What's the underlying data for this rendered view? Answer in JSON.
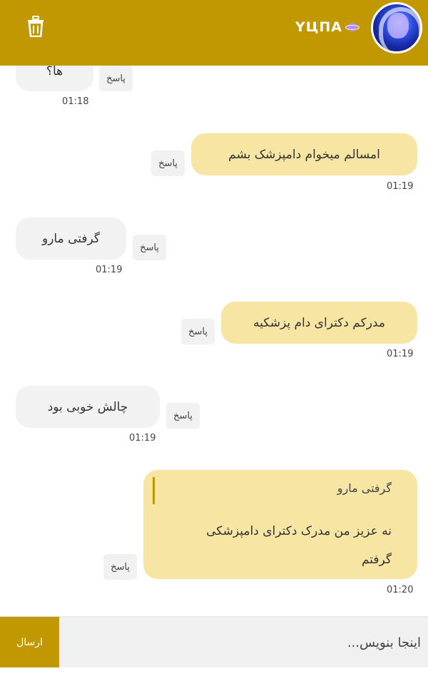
{
  "header": {
    "title": "YЦПA",
    "avatar_icon": "avatar",
    "delete_icon": "trash-icon",
    "planet_icon": "planet-icon",
    "background": "#c19802"
  },
  "messages": [
    {
      "direction": "in",
      "text": "ها؟",
      "reply_label": "پاسخ",
      "time": "01:18"
    },
    {
      "direction": "out",
      "text": "امسالم میخوام دامپزشک بشم",
      "reply_label": "پاسخ",
      "time": "01:19"
    },
    {
      "direction": "in",
      "text": "گرفتی مارو",
      "reply_label": "پاسخ",
      "time": "01:19"
    },
    {
      "direction": "out",
      "text": "مدرکم دکترای دام پزشکیه",
      "reply_label": "پاسخ",
      "time": "01:19"
    },
    {
      "direction": "in",
      "text": "چالش خوبی بود",
      "reply_label": "پاسخ",
      "time": "01:19"
    },
    {
      "direction": "out",
      "quoted_text": "گرفتی مارو",
      "text": "نه عزیز من مدرک دکترای دامپزشکی گرفتم",
      "reply_label": "پاسخ",
      "time": "01:20"
    }
  ],
  "composer": {
    "placeholder": "اینجا بنویس...",
    "send_label": "ارسال"
  },
  "colors": {
    "accent": "#c19802",
    "outgoing_bubble": "#f7e6a3",
    "incoming_bubble": "#f2f2f2"
  }
}
